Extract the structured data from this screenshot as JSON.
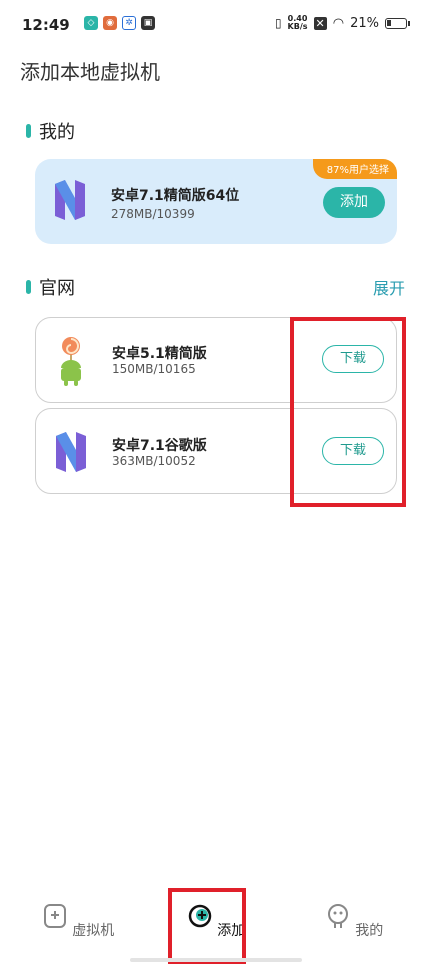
{
  "status_bar": {
    "time": "12:49",
    "net_speed": "0.40",
    "net_unit": "KB/s",
    "battery": "21%"
  },
  "page_title": "添加本地虚拟机",
  "sections": {
    "mine": {
      "title": "我的",
      "card": {
        "badge": "87%用户选择",
        "name": "安卓7.1精简版64位",
        "meta": "278MB/10399",
        "button": "添加",
        "icon": "android-nougat-icon"
      }
    },
    "official": {
      "title": "官网",
      "expand": "展开",
      "items": [
        {
          "name": "安卓5.1精简版",
          "meta": "150MB/10165",
          "button": "下载",
          "icon": "android-lollipop-icon"
        },
        {
          "name": "安卓7.1谷歌版",
          "meta": "363MB/10052",
          "button": "下载",
          "icon": "android-nougat-icon"
        }
      ]
    }
  },
  "bottom_nav": [
    {
      "label": "虚拟机",
      "icon": "virtual-machine-icon",
      "active": false
    },
    {
      "label": "添加",
      "icon": "add-icon",
      "active": true
    },
    {
      "label": "我的",
      "icon": "profile-icon",
      "active": false
    }
  ],
  "colors": {
    "accent": "#2bb5a8",
    "badge": "#f59a1b",
    "featured_bg": "#d9ecfb",
    "highlight": "#e0202a"
  }
}
